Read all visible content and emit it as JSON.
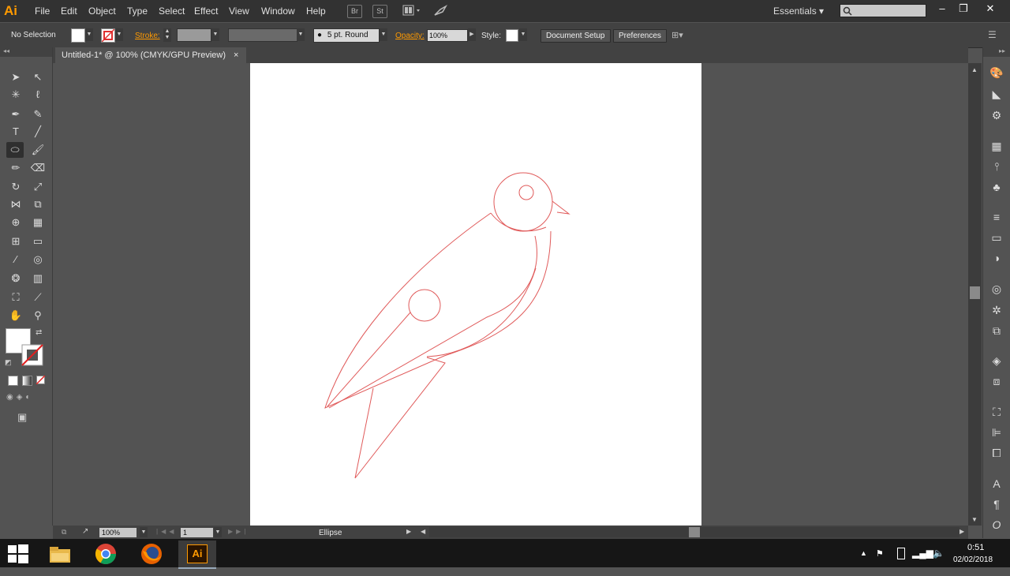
{
  "app": {
    "logo": "Ai"
  },
  "menu": [
    "File",
    "Edit",
    "Object",
    "Type",
    "Select",
    "Effect",
    "View",
    "Window",
    "Help"
  ],
  "menubar_icons": {
    "bridge": "Br",
    "stock": "St"
  },
  "workspace": "Essentials",
  "search": {
    "placeholder": "",
    "value": ""
  },
  "control_bar": {
    "selection": "No Selection",
    "stroke_label": "Stroke:",
    "brush": "5 pt. Round",
    "opacity_label": "Opacity:",
    "opacity_value": "100%",
    "style_label": "Style:",
    "document_setup": "Document Setup",
    "preferences": "Preferences"
  },
  "document": {
    "tab_title": "Untitled-1* @ 100% (CMYK/GPU Preview)",
    "close": "×"
  },
  "status": {
    "zoom": "100%",
    "artboard": "1",
    "tool": "Ellipse"
  },
  "taskbar": {
    "time": "0:51",
    "date": "02/02/2018",
    "ai_label": "Ai"
  },
  "colors": {
    "stroke": "#e05a5a",
    "accent": "#ff9a00",
    "artboard": "#ffffff",
    "workspace": "#535353"
  }
}
